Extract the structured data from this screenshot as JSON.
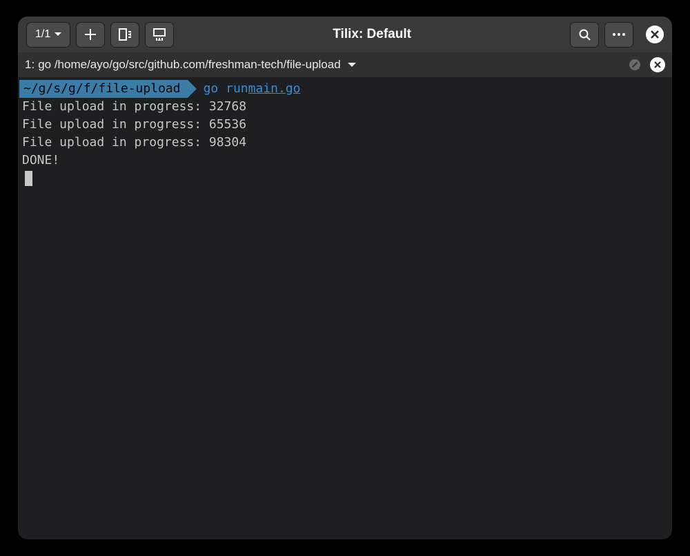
{
  "titlebar": {
    "session_counter": "1/1",
    "window_title": "Tilix: Default"
  },
  "tab": {
    "index": "1",
    "label": "go /home/ayo/go/src/github.com/freshman-tech/file-upload"
  },
  "terminal": {
    "prompt_path": "~/g/s/g/f/file-upload",
    "command_binary": "go",
    "command_args": "run ",
    "command_file": "main.go",
    "output": [
      "File upload in progress: 32768",
      "File upload in progress: 65536",
      "File upload in progress: 98304",
      "DONE!"
    ]
  },
  "colors": {
    "bg": "#1d1f21",
    "titlebar": "#393939",
    "prompt_bg": "#3a7ba8",
    "command": "#3a8cd8"
  }
}
